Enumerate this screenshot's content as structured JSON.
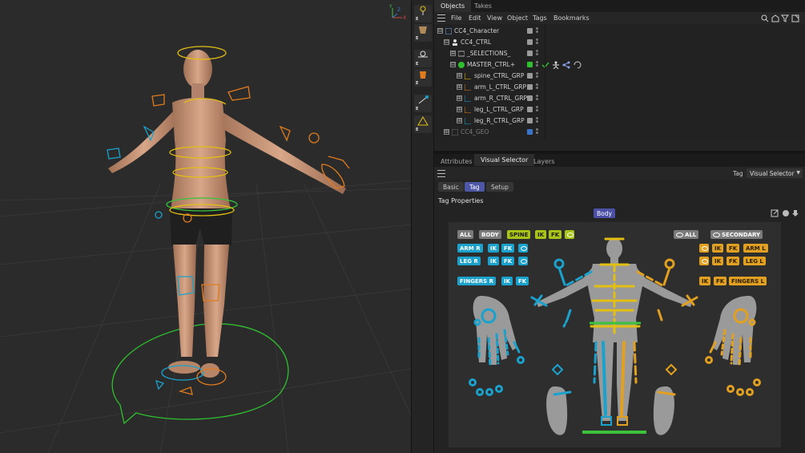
{
  "colors": {
    "accent": "#4b4fa6",
    "spine_green": "#a8c418",
    "right_orange": "#e2a021",
    "left_blue": "#1aa2cd",
    "foot_green": "#3bc43b"
  },
  "sidebar": {
    "items": [
      {
        "label": "E",
        "icon": "bone-tool-icon"
      },
      {
        "label": "E",
        "icon": "weight-tool-icon"
      },
      {
        "label": "E",
        "icon": "joint-tool-icon"
      },
      {
        "label": "E",
        "icon": "face-tool-icon"
      },
      {
        "label": "E",
        "icon": "ik-tool-icon"
      },
      {
        "label": "E",
        "icon": "constraint-tool-icon"
      }
    ]
  },
  "objects_panel": {
    "tabs": [
      "Objects",
      "Takes"
    ],
    "menu": [
      "File",
      "Edit",
      "View",
      "Object",
      "Tags",
      "Bookmarks"
    ],
    "tree": [
      {
        "name": "CC4_Character",
        "expander": "⊟"
      },
      {
        "name": "CC4_CTRL",
        "expander": "⊟"
      },
      {
        "name": "_SELECTIONS_",
        "expander": "⊞"
      },
      {
        "name": "MASTER_CTRL+",
        "expander": "⊟"
      },
      {
        "name": "spine_CTRL_GRP",
        "expander": "⊞"
      },
      {
        "name": "arm_L_CTRL_GRP",
        "expander": "⊞"
      },
      {
        "name": "arm_R_CTRL_GRP",
        "expander": "⊞"
      },
      {
        "name": "leg_L_CTRL_GRP",
        "expander": "⊞"
      },
      {
        "name": "leg_R_CTRL_GRP",
        "expander": "⊞"
      },
      {
        "name": "CC4_GEO",
        "expander": "⊞"
      }
    ]
  },
  "attributes_panel": {
    "tabs": [
      "Attributes",
      "Visual Selector",
      "Layers"
    ],
    "mode_label": "Tag",
    "mode_value": "Visual Selector",
    "subtabs": [
      "Basic",
      "Tag",
      "Setup"
    ],
    "section_title": "Tag Properties",
    "body_badge": "Body"
  },
  "visual_selector": {
    "buttons": {
      "all": "ALL",
      "body": "BODY",
      "spine": "SPINE",
      "ik": "IK",
      "fk": "FK",
      "all_eye": "ALL",
      "secondary": "SECONDARY",
      "arm_r": "ARM R",
      "arm_l": "ARM L",
      "leg_r": "LEG R",
      "leg_l": "LEG L",
      "fingers_r": "FINGERS R",
      "fingers_l": "FINGERS L"
    }
  }
}
